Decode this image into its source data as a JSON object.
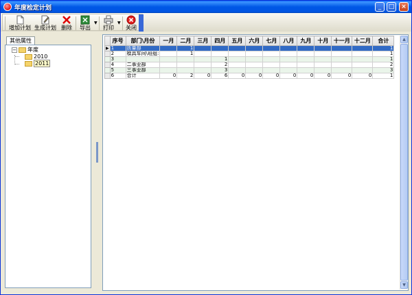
{
  "window": {
    "title": "年度检定计划"
  },
  "toolbar": {
    "add_plan": "增加计划",
    "gen_plan": "生成计划",
    "delete": "删除",
    "export": "导出",
    "print": "打印",
    "close": "关闭"
  },
  "left_panel": {
    "tab": "其他属性",
    "tree": {
      "root": "年度",
      "children": [
        "2010",
        "2011"
      ],
      "selected": "2011"
    }
  },
  "grid": {
    "headers": [
      "序号",
      "部门\\月份",
      "一月",
      "二月",
      "三月",
      "四月",
      "五月",
      "六月",
      "七月",
      "八月",
      "九月",
      "十月",
      "十一月",
      "十二月",
      "合计"
    ],
    "rows": [
      [
        "1",
        "质量部",
        "",
        "1",
        "",
        "",
        "",
        "",
        "",
        "",
        "",
        "",
        "",
        "",
        "1"
      ],
      [
        "2",
        "模具车间\\班组:",
        "",
        "1",
        "",
        "",
        "",
        "",
        "",
        "",
        "",
        "",
        "",
        "",
        "1"
      ],
      [
        "3",
        "",
        "",
        "",
        "",
        "1",
        "",
        "",
        "",
        "",
        "",
        "",
        "",
        "",
        "1"
      ],
      [
        "4",
        "二事业部",
        "",
        "",
        "",
        "2",
        "",
        "",
        "",
        "",
        "",
        "",
        "",
        "",
        "2"
      ],
      [
        "5",
        "三事业部",
        "",
        "",
        "",
        "3",
        "",
        "",
        "",
        "",
        "",
        "",
        "",
        "",
        "3"
      ],
      [
        "6",
        "合计",
        "0",
        "2",
        "0",
        "6",
        "0",
        "0",
        "0",
        "0",
        "0",
        "0",
        "0",
        "0",
        "1"
      ]
    ],
    "selected_row": 0
  }
}
